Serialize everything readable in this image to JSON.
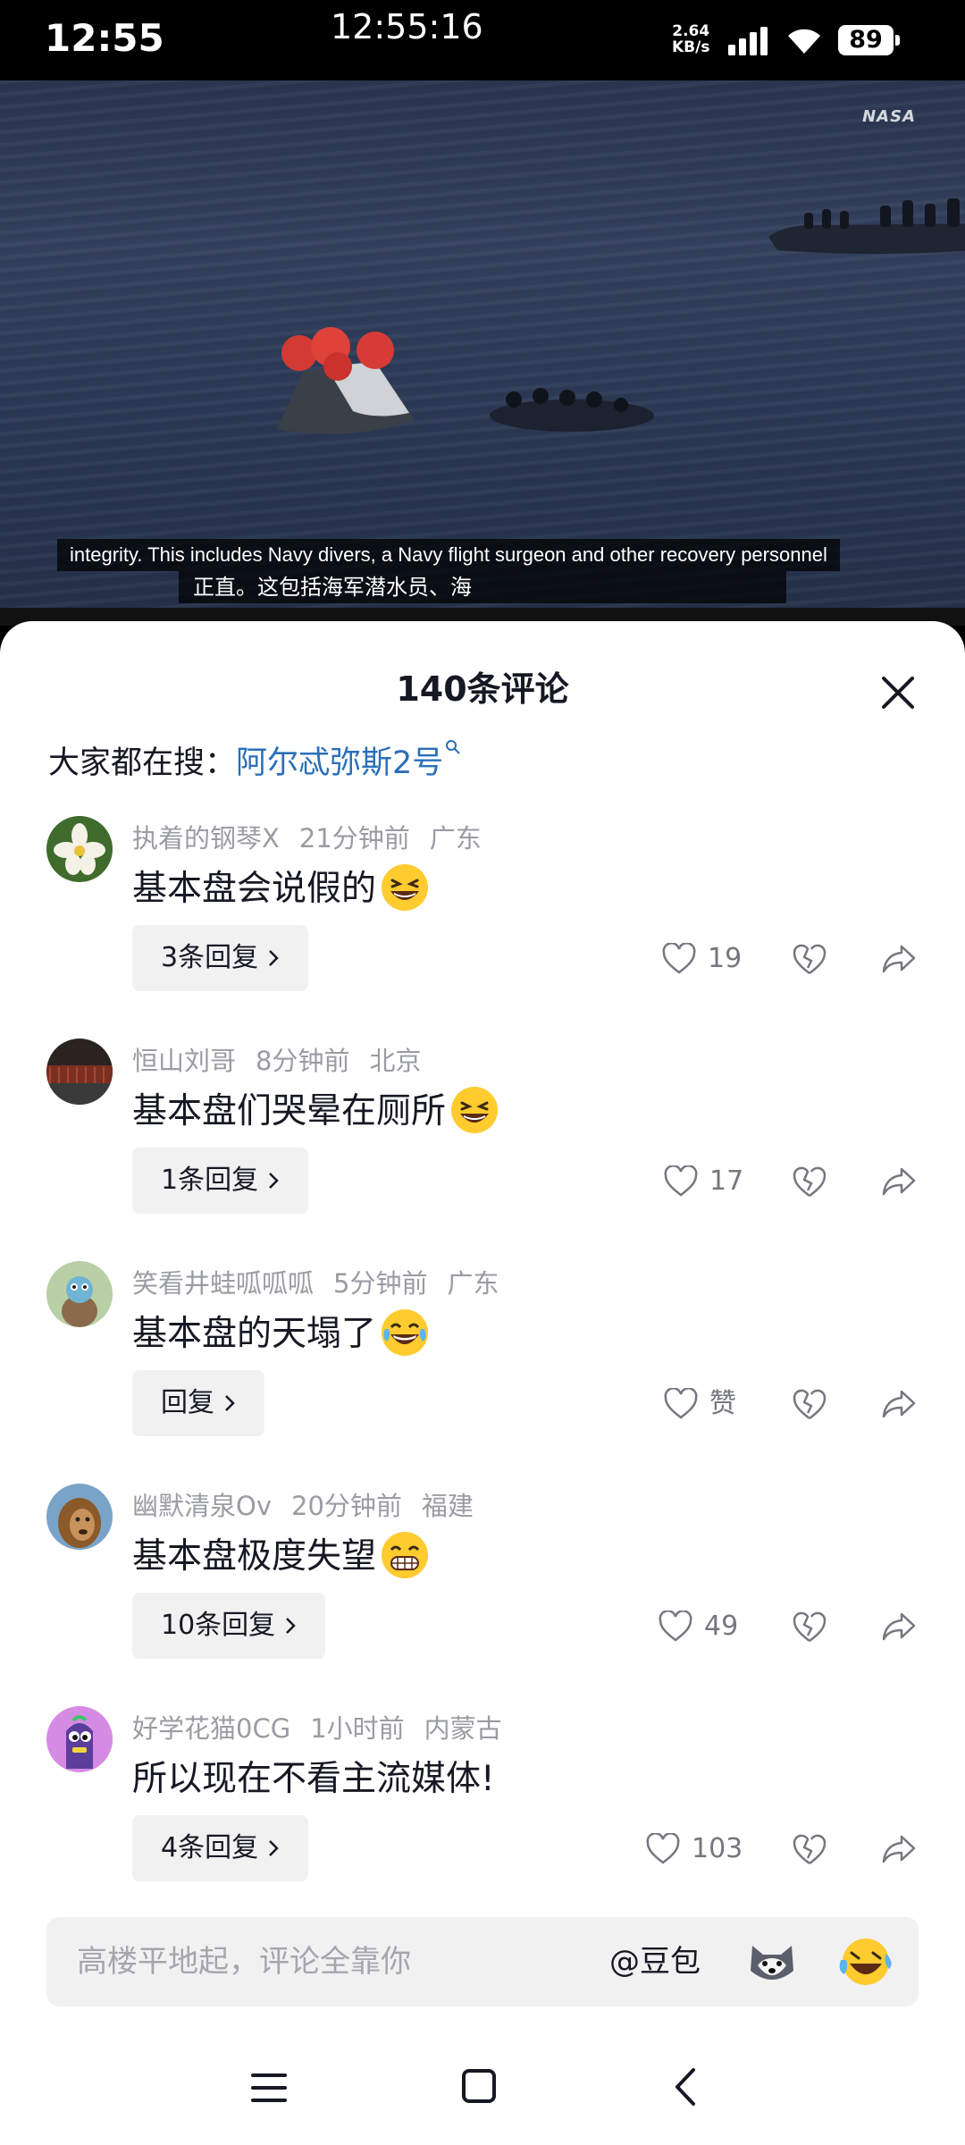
{
  "status_bar": {
    "time": "12:55",
    "clock_center": "12:55:16",
    "net_speed_value": "2.64",
    "net_speed_unit": "KB/s",
    "battery": "89"
  },
  "video": {
    "watermark": "NASA",
    "subtitle_en": "integrity. This includes Navy divers, a Navy flight surgeon and other recovery personnel",
    "subtitle_zh": "正直。这包括海军潜水员、海"
  },
  "sheet": {
    "title": "140条评论",
    "search_prefix": "大家都在搜：",
    "search_term": "阿尔忒弥斯2号"
  },
  "comments": [
    {
      "user": "执着的钢琴X",
      "time": "21分钟前",
      "location": "广东",
      "text": "基本盘会说假的",
      "emoji": "laugh-icon",
      "replies": "3条回复",
      "likes": "19"
    },
    {
      "user": "恒山刘哥",
      "time": "8分钟前",
      "location": "北京",
      "text": "基本盘们哭晕在厕所",
      "emoji": "laugh-icon",
      "replies": "1条回复",
      "likes": "17"
    },
    {
      "user": "笑看井蛙呱呱呱",
      "time": "5分钟前",
      "location": "广东",
      "text": "基本盘的天塌了",
      "emoji": "tears-of-joy-icon",
      "replies": "回复",
      "likes": "赞"
    },
    {
      "user": "幽默清泉Ov",
      "time": "20分钟前",
      "location": "福建",
      "text": "基本盘极度失望",
      "emoji": "grin-icon",
      "replies": "10条回复",
      "likes": "49"
    },
    {
      "user": "好学花猫0CG",
      "time": "1小时前",
      "location": "内蒙古",
      "text": "所以现在不看主流媒体!",
      "emoji": "",
      "replies": "4条回复",
      "likes": "103"
    }
  ],
  "input": {
    "placeholder": "高楼平地起，评论全靠你",
    "mention": "@豆包"
  },
  "colors": {
    "link": "#2a6fba",
    "meta_text": "#9a9ca3",
    "reply_bg": "#f1f1f2"
  }
}
